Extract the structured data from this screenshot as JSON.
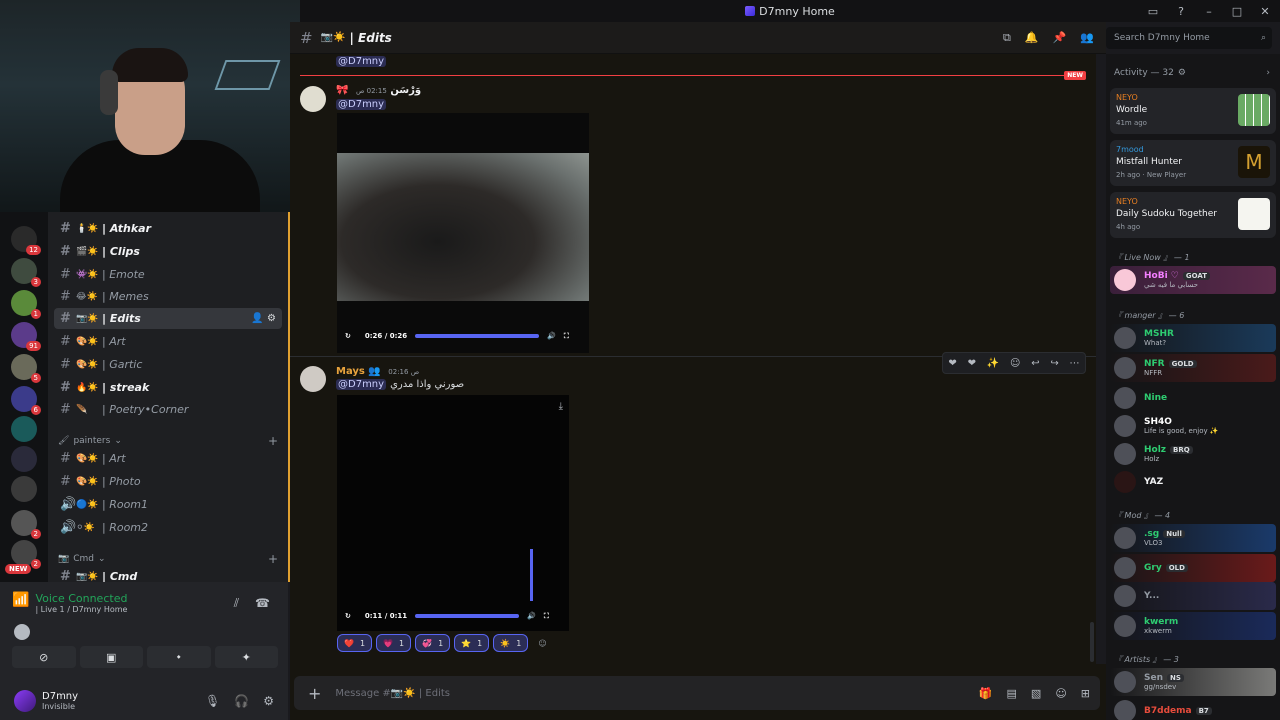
{
  "window": {
    "title": "D7mny Home",
    "controls": [
      "inbox-icon",
      "help-icon",
      "minimize",
      "maximize",
      "close"
    ]
  },
  "webcam": {
    "description_icon": "streamer-webcam"
  },
  "servers": {
    "badges": [
      "12",
      "3",
      "1",
      "91",
      "5",
      "6",
      "2",
      "2"
    ],
    "new_label": "NEW"
  },
  "channels": {
    "items": [
      {
        "emoji": "🕯️☀️",
        "name": "| Athkar",
        "style": "bold"
      },
      {
        "emoji": "🎬☀️",
        "name": "| Clips",
        "style": "bold"
      },
      {
        "emoji": "👾☀️",
        "name": "| Emote",
        "style": "muted"
      },
      {
        "emoji": "😂☀️",
        "name": "| Memes",
        "style": "muted"
      },
      {
        "emoji": "📷☀️",
        "name": "| Edits",
        "style": "active"
      },
      {
        "emoji": "🎨☀️",
        "name": "| Art",
        "style": "muted"
      },
      {
        "emoji": "🎨☀️",
        "name": "| Gartic",
        "style": "muted"
      },
      {
        "emoji": "🔥☀️",
        "name": "| streak",
        "style": "bold"
      },
      {
        "emoji": "🪶",
        "name": "| Poetry•Corner",
        "style": "muted"
      }
    ],
    "category_painters": "painters",
    "painters_items": [
      {
        "emoji": "🎨☀️",
        "name": "| Art"
      },
      {
        "emoji": "🎨☀️",
        "name": "| Photo"
      },
      {
        "emoji": "🔵☀️",
        "name": "| Room1"
      },
      {
        "emoji": "⚪☀️",
        "name": "| Room2"
      }
    ],
    "category_cmd": "Cmd",
    "cmd_item": {
      "emoji": "📷☀️",
      "name": "| Cmd"
    }
  },
  "voice": {
    "status": "Voice Connected",
    "detail": "| Live 1 / D7mny Home"
  },
  "user": {
    "name": "D7mny",
    "status": "Invisible"
  },
  "channel_header": {
    "name": "| Edits",
    "search_placeholder": "Search D7mny Home"
  },
  "messages": {
    "top_mention": "@D7mny",
    "new_label": "NEW",
    "msg1": {
      "author": "🎀 وَرْسَن",
      "time": "02:15 ص",
      "mention": "@D7mny",
      "video_time": "0:26 / 0:26"
    },
    "msg2": {
      "author": "Mays 👥",
      "time": "02:16 ص",
      "mention": "@D7mny",
      "text": "صورني واذا مدري",
      "video_time": "0:11 / 0:11"
    },
    "reactions": [
      {
        "emoji": "❤️",
        "count": "1"
      },
      {
        "emoji": "💗",
        "count": "1"
      },
      {
        "emoji": "💞",
        "count": "1"
      },
      {
        "emoji": "⭐",
        "count": "1"
      },
      {
        "emoji": "☀️",
        "count": "1"
      }
    ]
  },
  "composer": {
    "placeholder": "Message #📷☀️ | Edits"
  },
  "sidebar": {
    "activity_header": "Activity — 32",
    "activities": [
      {
        "user": "NEYO",
        "game": "Wordle",
        "ago": "41m ago",
        "extra": ""
      },
      {
        "user": "7mood",
        "game": "Mistfall Hunter",
        "ago": "2h ago",
        "extra": "New Player"
      },
      {
        "user": "NEYO",
        "game": "Daily Sudoku Together",
        "ago": "4h ago",
        "extra": ""
      }
    ],
    "sections": [
      {
        "title": "『 Live Now 』 — 1",
        "members": [
          {
            "name": "HoBi ♡",
            "tag": "GOAT",
            "sub": "حسابي ما فيه شي",
            "color": "#f47fff"
          }
        ]
      },
      {
        "title": "『 manger 』 — 6",
        "members": [
          {
            "name": "MSHR",
            "tag": "",
            "sub": "What?",
            "color": "#2ecc71"
          },
          {
            "name": "NFR",
            "tag": "GOLD",
            "sub": "NFFR",
            "color": "#2ecc71"
          },
          {
            "name": "Nine",
            "tag": "",
            "sub": "",
            "color": "#2ecc71"
          },
          {
            "name": "SH4O",
            "tag": "",
            "sub": "Life is good, enjoy ✨",
            "color": "#ffffff"
          },
          {
            "name": "Holz",
            "tag": "BRQ",
            "sub": "Holz",
            "color": "#2ecc71"
          },
          {
            "name": "YAZ",
            "tag": "",
            "sub": "",
            "color": "#f2f3f5"
          }
        ]
      },
      {
        "title": "『 Mod 』 — 4",
        "members": [
          {
            "name": ".sg",
            "tag": "Null",
            "sub": "VLO3",
            "color": "#2ecc71"
          },
          {
            "name": "Gry",
            "tag": "OLD",
            "sub": "",
            "color": "#2ecc71"
          },
          {
            "name": "Y...",
            "tag": "",
            "sub": "",
            "color": "#949ba4"
          },
          {
            "name": "kwerm",
            "tag": "",
            "sub": "xkwerm",
            "color": "#2ecc71"
          }
        ]
      },
      {
        "title": "『 Artists 』 — 3",
        "members": [
          {
            "name": "Sen",
            "tag": "NS",
            "sub": "gg/nsdev",
            "color": "#949ba4"
          },
          {
            "name": "B7ddema",
            "tag": "B7",
            "sub": "",
            "color": "#e74c3c"
          }
        ]
      }
    ]
  }
}
